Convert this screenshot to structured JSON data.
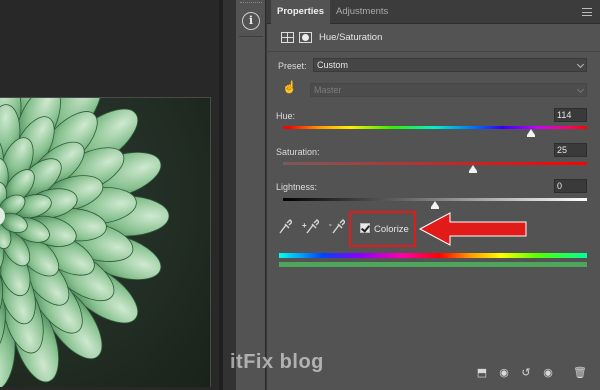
{
  "panel": {
    "tabs": [
      {
        "label": "Properties",
        "active": true
      },
      {
        "label": "Adjustments",
        "active": false
      }
    ],
    "title": "Hue/Saturation",
    "preset": {
      "label": "Preset:",
      "value": "Custom"
    },
    "channel": {
      "value": "Master",
      "disabled": true
    },
    "sliders": {
      "hue": {
        "label": "Hue:",
        "value": "114",
        "range": [
          -180,
          180
        ]
      },
      "saturation": {
        "label": "Saturation:",
        "value": "25",
        "range": [
          -100,
          100
        ]
      },
      "lightness": {
        "label": "Lightness:",
        "value": "0",
        "range": [
          -100,
          100
        ]
      }
    },
    "eyedroppers": [
      {
        "icon": "eyedropper-icon"
      },
      {
        "icon": "eyedropper-plus-icon",
        "badge": "+"
      },
      {
        "icon": "eyedropper-minus-icon",
        "badge": "-"
      }
    ],
    "colorize": {
      "label": "Colorize",
      "checked": true
    },
    "colors": {
      "highlight": "#e11a1a",
      "result_bar": "#4fa55c"
    }
  },
  "dock": {
    "icon": "info-icon"
  },
  "watermark": "itFix blog"
}
